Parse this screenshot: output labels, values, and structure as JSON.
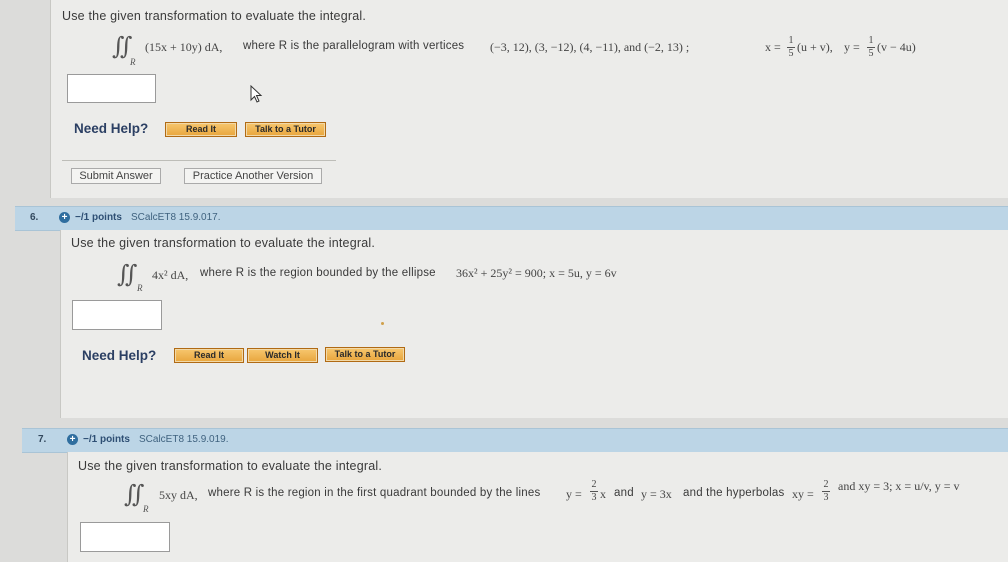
{
  "q5": {
    "prompt": "Use the given transformation to evaluate the integral.",
    "integrand": "(15x + 10y) dA,",
    "condition": "where R is the parallelogram with vertices",
    "vertices": "(−3, 12),   (3, −12),   (4, −11),   and   (−2, 13) ;",
    "transform_x_prefix": "x =",
    "transform_frac_num": "1",
    "transform_frac_den": "5",
    "transform_x_suffix": "(u + v),",
    "transform_y_prefix": "y =",
    "transform_y_frac_num": "1",
    "transform_y_frac_den": "5",
    "transform_y_suffix": "(v − 4u)",
    "region_sub": "R",
    "need_help": "Need Help?",
    "read_it": "Read It",
    "talk_tutor": "Talk to a Tutor",
    "submit": "Submit Answer",
    "practice": "Practice Another Version"
  },
  "q6": {
    "number": "6.",
    "points": "−/1 points",
    "problem_id": "SCalcET8 15.9.017.",
    "prompt": "Use the given transformation to evaluate the integral.",
    "integrand": "4x² dA,",
    "condition": "where R is the region bounded by the ellipse",
    "equation": "36x² + 25y² = 900;   x = 5u,   y = 6v",
    "region_sub": "R",
    "need_help": "Need Help?",
    "read_it": "Read It",
    "watch_it": "Watch It",
    "talk_tutor": "Talk to a Tutor"
  },
  "q7": {
    "number": "7.",
    "points": "−/1 points",
    "problem_id": "SCalcET8 15.9.019.",
    "prompt": "Use the given transformation to evaluate the integral.",
    "integrand": "5xy dA,",
    "condition": "where R is the region in the first quadrant bounded by the lines",
    "line1_prefix": "y =",
    "line1_frac_num": "2",
    "line1_frac_den": "3",
    "line1_suffix": "x",
    "and1": "and",
    "line2": "y = 3x",
    "hyper_text": "and the hyperbolas",
    "hyper1_prefix": "xy =",
    "hyper1_frac_num": "2",
    "hyper1_frac_den": "3",
    "rest": "and  xy = 3;  x = u/v,  y = v",
    "region_sub": "R"
  },
  "colors": {
    "help_text": "#2b3f63",
    "button_orange": "#e8a53c",
    "question_bar": "#bcd5e6",
    "plus_icon": "#2f6e9f"
  }
}
